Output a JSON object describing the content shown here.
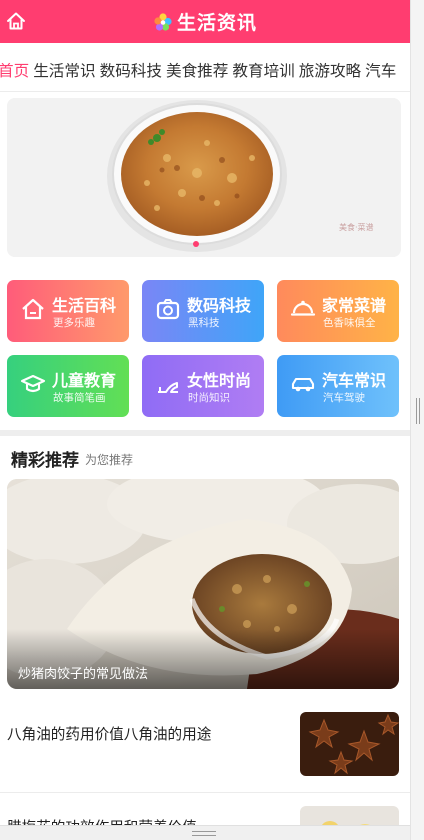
{
  "header": {
    "title": "生活资讯",
    "home_icon": "home-icon",
    "logo_icon": "colorful-flower-logo"
  },
  "tabs": [
    {
      "label": "首页",
      "active": true
    },
    {
      "label": "生活常识",
      "active": false
    },
    {
      "label": "数码科技",
      "active": false
    },
    {
      "label": "美食推荐",
      "active": false
    },
    {
      "label": "教育培训",
      "active": false
    },
    {
      "label": "旅游攻略",
      "active": false
    },
    {
      "label": "汽车",
      "active": false
    }
  ],
  "categories": [
    {
      "name": "生活百科",
      "sub": "更多乐趣",
      "icon": "house-icon",
      "colors": [
        "#ff5c7a",
        "#ff9a6b"
      ]
    },
    {
      "name": "数码科技",
      "sub": "黑科技",
      "icon": "camera-icon",
      "colors": [
        "#7a86f6",
        "#3fa5f8"
      ]
    },
    {
      "name": "家常菜谱",
      "sub": "色香味俱全",
      "icon": "dish-icon",
      "colors": [
        "#ff8a5c",
        "#ffb347"
      ]
    },
    {
      "name": "儿童教育",
      "sub": "故事简笔画",
      "icon": "graduation-cap-icon",
      "colors": [
        "#3ad17c",
        "#6ae05a"
      ]
    },
    {
      "name": "女性时尚",
      "sub": "时尚知识",
      "icon": "high-heel-icon",
      "colors": [
        "#8f6cf5",
        "#b07df3"
      ]
    },
    {
      "name": "汽车常识",
      "sub": "汽车驾驶",
      "icon": "car-icon",
      "colors": [
        "#3f9bf5",
        "#6fc1fb"
      ]
    }
  ],
  "section": {
    "title": "精彩推荐",
    "subtitle": "为您推荐"
  },
  "feature": {
    "caption": "炒猪肉饺子的常见做法"
  },
  "articles": [
    {
      "title": "八角油的药用价值八角油的用途",
      "thumb": "star-anise-thumbnail"
    },
    {
      "title": "腊梅花的功效作用和营养价值",
      "thumb": "wintersweet-thumbnail"
    }
  ],
  "colors": {
    "brand": "#ff3d70",
    "active_tab": "#ff3d70"
  }
}
